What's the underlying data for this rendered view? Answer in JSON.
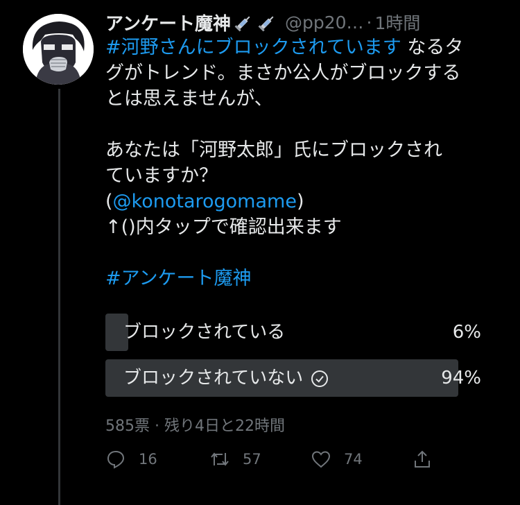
{
  "tweet": {
    "display_name": "アンケート魔神",
    "name_emoji": [
      "syringe-icon",
      "syringe-icon"
    ],
    "handle": "@pp20…",
    "separator": "·",
    "time": "1時間",
    "text": {
      "hashtag1": "#河野さんにブロックされています",
      "line1_rest": " なるタ",
      "line2": "グがトレンド。まさか公人がブロックする",
      "line3": "とは思えませんが、",
      "line4": "あなたは「河野太郎」氏にブロックされ",
      "line5": "ていますか？",
      "paren_open": "(",
      "mention": "@konotarogomame",
      "paren_close": ")",
      "line7": "↑()内タップで確認出来ます",
      "hashtag2": "#アンケート魔神"
    }
  },
  "poll": {
    "options": [
      {
        "label": "ブロックされている",
        "percent_text": "6%",
        "percent": 6,
        "winner": false
      },
      {
        "label": "ブロックされていない",
        "percent_text": "94%",
        "percent": 94,
        "winner": true
      }
    ],
    "meta": "585票 · 残り4日と22時間"
  },
  "actions": {
    "reply_count": "16",
    "retweet_count": "57",
    "like_count": "74"
  },
  "colors": {
    "background": "#000000",
    "text": "#e7e9ea",
    "secondary": "#71767b",
    "link": "#1d9bf0",
    "poll_bar": "#333639"
  }
}
